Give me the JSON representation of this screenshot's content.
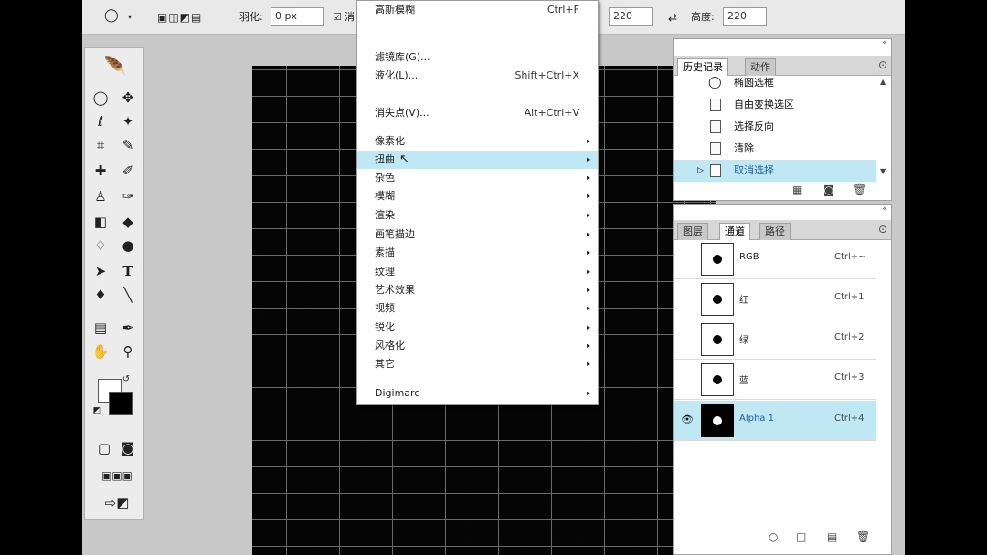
{
  "options_bar": {
    "feather_label": "羽化:",
    "feather_value": "0 px",
    "antialias_label": "消",
    "width_value": "220",
    "height_label": "高度:",
    "height_value": "220"
  },
  "filter_menu": {
    "items": [
      {
        "label": "高斯模糊",
        "shortcut": "Ctrl+F"
      },
      {
        "label": "滤镜库(G)...",
        "shortcut": ""
      },
      {
        "label": "液化(L)...",
        "shortcut": "Shift+Ctrl+X"
      },
      {
        "label": "消失点(V)...",
        "shortcut": "Alt+Ctrl+V"
      },
      {
        "label": "像素化",
        "submenu": true
      },
      {
        "label": "扭曲",
        "submenu": true,
        "highlighted": true
      },
      {
        "label": "杂色",
        "submenu": true
      },
      {
        "label": "模糊",
        "submenu": true
      },
      {
        "label": "渲染",
        "submenu": true
      },
      {
        "label": "画笔描边",
        "submenu": true
      },
      {
        "label": "素描",
        "submenu": true
      },
      {
        "label": "纹理",
        "submenu": true
      },
      {
        "label": "艺术效果",
        "submenu": true
      },
      {
        "label": "视频",
        "submenu": true
      },
      {
        "label": "锐化",
        "submenu": true
      },
      {
        "label": "风格化",
        "submenu": true
      },
      {
        "label": "其它",
        "submenu": true
      },
      {
        "label": "Digimarc",
        "submenu": true
      }
    ]
  },
  "history_panel": {
    "tabs": [
      "历史记录",
      "动作"
    ],
    "items": [
      "椭圆选框",
      "自由变换选区",
      "选择反向",
      "清除",
      "取消选择"
    ],
    "selected_index": 4
  },
  "channels_panel": {
    "tabs": [
      "图层",
      "通道",
      "路径"
    ],
    "channels": [
      {
        "name": "RGB",
        "shortcut": "Ctrl+~"
      },
      {
        "name": "红",
        "shortcut": "Ctrl+1"
      },
      {
        "name": "绿",
        "shortcut": "Ctrl+2"
      },
      {
        "name": "蓝",
        "shortcut": "Ctrl+3"
      },
      {
        "name": "Alpha 1",
        "shortcut": "Ctrl+4",
        "selected": true
      }
    ]
  },
  "icons": {
    "selection_tool": "ellipse-marquee-icon",
    "menu_arrow": "▸"
  },
  "colors": {
    "highlight": "#bfe8f4",
    "canvas": "#050505",
    "grid": "#6a6a6a",
    "link_text": "#1a5fa0"
  }
}
